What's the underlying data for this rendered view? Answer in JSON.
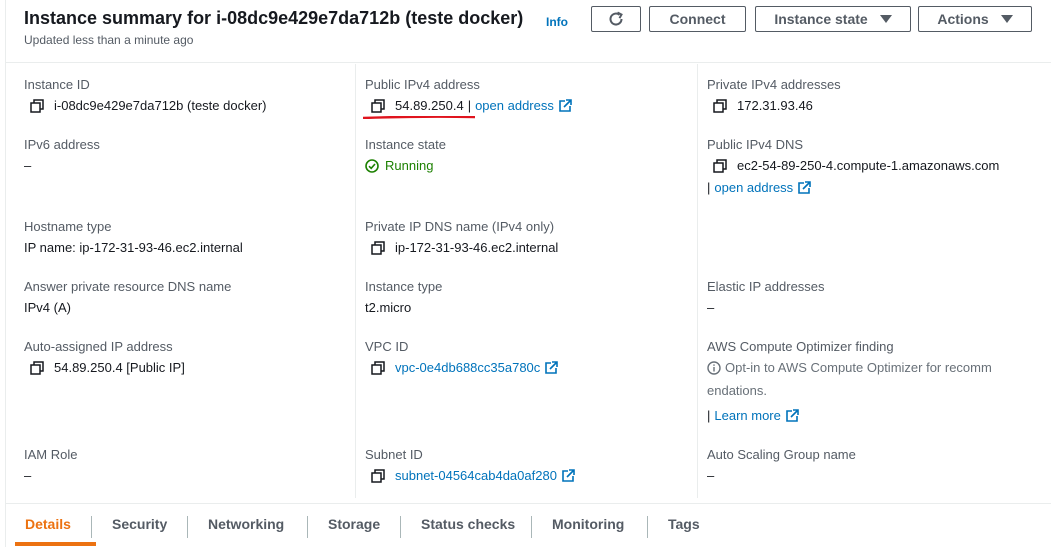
{
  "header": {
    "title": "Instance summary for i-08dc9e429e7da712b (teste docker)",
    "info": "Info",
    "updated": "Updated less than a minute ago",
    "connect": "Connect",
    "instance_state": "Instance state",
    "actions": "Actions"
  },
  "col1": {
    "instance_id_label": "Instance ID",
    "instance_id_value": "i-08dc9e429e7da712b (teste docker)",
    "ipv6_label": "IPv6 address",
    "ipv6_value": "–",
    "hostname_type_label": "Hostname type",
    "hostname_type_value": "IP name: ip-172-31-93-46.ec2.internal",
    "answer_dns_label": "Answer private resource DNS name",
    "answer_dns_value": "IPv4 (A)",
    "auto_ip_label": "Auto-assigned IP address",
    "auto_ip_value": "54.89.250.4 [Public IP]",
    "iam_label": "IAM Role",
    "iam_value": "–"
  },
  "col2": {
    "public_ipv4_label": "Public IPv4 address",
    "public_ipv4_value": "54.89.250.4",
    "pipe": "|",
    "open_address": "open address",
    "instance_state_label": "Instance state",
    "instance_state_value": "Running",
    "private_dns_label": "Private IP DNS name (IPv4 only)",
    "private_dns_value": "ip-172-31-93-46.ec2.internal",
    "instance_type_label": "Instance type",
    "instance_type_value": "t2.micro",
    "vpc_label": "VPC ID",
    "vpc_value": "vpc-0e4db688cc35a780c",
    "subnet_label": "Subnet ID",
    "subnet_value": "subnet-04564cab4da0af280"
  },
  "col3": {
    "private_ipv4_label": "Private IPv4 addresses",
    "private_ipv4_value": "172.31.93.46",
    "public_dns_label": "Public IPv4 DNS",
    "public_dns_value": "ec2-54-89-250-4.compute-1.amazonaws.com",
    "pipe": "|",
    "open_address": "open address",
    "elastic_label": "Elastic IP addresses",
    "elastic_value": "–",
    "optimizer_label": "AWS Compute Optimizer finding",
    "optimizer_line1": "Opt-in to AWS Compute Optimizer for recomm",
    "optimizer_line2": "endations.",
    "learn_more": "Learn more",
    "asg_label": "Auto Scaling Group name",
    "asg_value": "–"
  },
  "tabs": [
    "Details",
    "Security",
    "Networking",
    "Storage",
    "Status checks",
    "Monitoring",
    "Tags"
  ],
  "colors": {
    "accent": "#ec7211",
    "link": "#0073bb",
    "running": "#1d8102",
    "annotation": "#e0141e"
  }
}
